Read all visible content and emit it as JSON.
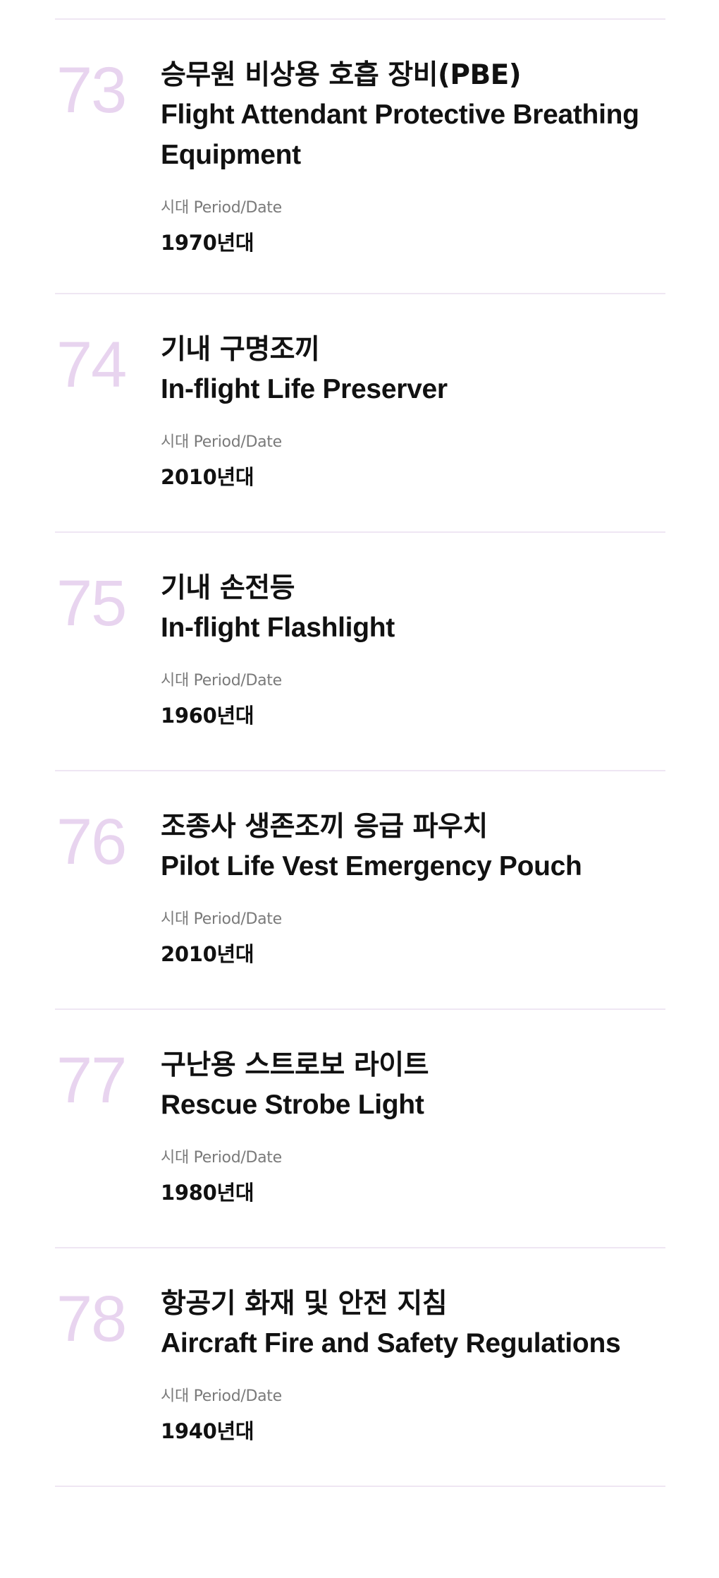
{
  "period_label": "시대 Period/Date",
  "colors": {
    "number": "#e8d4ef",
    "divider": "#efe6f3",
    "label": "#7a7a7a",
    "text": "#111111"
  },
  "items": [
    {
      "number": "73",
      "title_ko": "승무원 비상용 호흡 장비(PBE)",
      "title_en": "Flight Attendant Protective Breathing Equipment",
      "period": "1970년대"
    },
    {
      "number": "74",
      "title_ko": "기내 구명조끼",
      "title_en": "In-flight Life Preserver",
      "period": "2010년대"
    },
    {
      "number": "75",
      "title_ko": "기내 손전등",
      "title_en": "In-flight Flashlight",
      "period": "1960년대"
    },
    {
      "number": "76",
      "title_ko": "조종사 생존조끼 응급 파우치",
      "title_en": "Pilot Life Vest Emergency Pouch",
      "period": "2010년대"
    },
    {
      "number": "77",
      "title_ko": "구난용 스트로보 라이트",
      "title_en": "Rescue Strobe Light",
      "period": "1980년대"
    },
    {
      "number": "78",
      "title_ko": "항공기 화재 및 안전 지침",
      "title_en": "Aircraft Fire and Safety Regulations",
      "period": "1940년대"
    }
  ]
}
